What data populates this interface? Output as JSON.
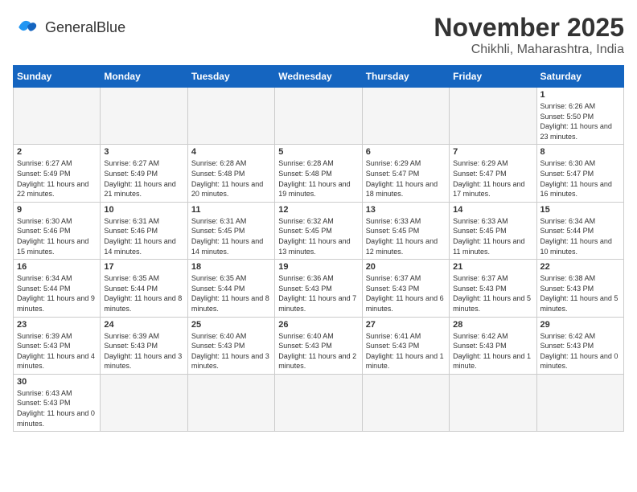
{
  "header": {
    "logo_general": "General",
    "logo_blue": "Blue",
    "month": "November 2025",
    "location": "Chikhli, Maharashtra, India"
  },
  "weekdays": [
    "Sunday",
    "Monday",
    "Tuesday",
    "Wednesday",
    "Thursday",
    "Friday",
    "Saturday"
  ],
  "days": [
    {
      "date": "",
      "sunrise": "",
      "sunset": "",
      "daylight": ""
    },
    {
      "date": "",
      "sunrise": "",
      "sunset": "",
      "daylight": ""
    },
    {
      "date": "",
      "sunrise": "",
      "sunset": "",
      "daylight": ""
    },
    {
      "date": "",
      "sunrise": "",
      "sunset": "",
      "daylight": ""
    },
    {
      "date": "",
      "sunrise": "",
      "sunset": "",
      "daylight": ""
    },
    {
      "date": "",
      "sunrise": "",
      "sunset": "",
      "daylight": ""
    },
    {
      "date": "1",
      "sunrise": "Sunrise: 6:26 AM",
      "sunset": "Sunset: 5:50 PM",
      "daylight": "Daylight: 11 hours and 23 minutes."
    },
    {
      "date": "2",
      "sunrise": "Sunrise: 6:27 AM",
      "sunset": "Sunset: 5:49 PM",
      "daylight": "Daylight: 11 hours and 22 minutes."
    },
    {
      "date": "3",
      "sunrise": "Sunrise: 6:27 AM",
      "sunset": "Sunset: 5:49 PM",
      "daylight": "Daylight: 11 hours and 21 minutes."
    },
    {
      "date": "4",
      "sunrise": "Sunrise: 6:28 AM",
      "sunset": "Sunset: 5:48 PM",
      "daylight": "Daylight: 11 hours and 20 minutes."
    },
    {
      "date": "5",
      "sunrise": "Sunrise: 6:28 AM",
      "sunset": "Sunset: 5:48 PM",
      "daylight": "Daylight: 11 hours and 19 minutes."
    },
    {
      "date": "6",
      "sunrise": "Sunrise: 6:29 AM",
      "sunset": "Sunset: 5:47 PM",
      "daylight": "Daylight: 11 hours and 18 minutes."
    },
    {
      "date": "7",
      "sunrise": "Sunrise: 6:29 AM",
      "sunset": "Sunset: 5:47 PM",
      "daylight": "Daylight: 11 hours and 17 minutes."
    },
    {
      "date": "8",
      "sunrise": "Sunrise: 6:30 AM",
      "sunset": "Sunset: 5:47 PM",
      "daylight": "Daylight: 11 hours and 16 minutes."
    },
    {
      "date": "9",
      "sunrise": "Sunrise: 6:30 AM",
      "sunset": "Sunset: 5:46 PM",
      "daylight": "Daylight: 11 hours and 15 minutes."
    },
    {
      "date": "10",
      "sunrise": "Sunrise: 6:31 AM",
      "sunset": "Sunset: 5:46 PM",
      "daylight": "Daylight: 11 hours and 14 minutes."
    },
    {
      "date": "11",
      "sunrise": "Sunrise: 6:31 AM",
      "sunset": "Sunset: 5:45 PM",
      "daylight": "Daylight: 11 hours and 14 minutes."
    },
    {
      "date": "12",
      "sunrise": "Sunrise: 6:32 AM",
      "sunset": "Sunset: 5:45 PM",
      "daylight": "Daylight: 11 hours and 13 minutes."
    },
    {
      "date": "13",
      "sunrise": "Sunrise: 6:33 AM",
      "sunset": "Sunset: 5:45 PM",
      "daylight": "Daylight: 11 hours and 12 minutes."
    },
    {
      "date": "14",
      "sunrise": "Sunrise: 6:33 AM",
      "sunset": "Sunset: 5:45 PM",
      "daylight": "Daylight: 11 hours and 11 minutes."
    },
    {
      "date": "15",
      "sunrise": "Sunrise: 6:34 AM",
      "sunset": "Sunset: 5:44 PM",
      "daylight": "Daylight: 11 hours and 10 minutes."
    },
    {
      "date": "16",
      "sunrise": "Sunrise: 6:34 AM",
      "sunset": "Sunset: 5:44 PM",
      "daylight": "Daylight: 11 hours and 9 minutes."
    },
    {
      "date": "17",
      "sunrise": "Sunrise: 6:35 AM",
      "sunset": "Sunset: 5:44 PM",
      "daylight": "Daylight: 11 hours and 8 minutes."
    },
    {
      "date": "18",
      "sunrise": "Sunrise: 6:35 AM",
      "sunset": "Sunset: 5:44 PM",
      "daylight": "Daylight: 11 hours and 8 minutes."
    },
    {
      "date": "19",
      "sunrise": "Sunrise: 6:36 AM",
      "sunset": "Sunset: 5:43 PM",
      "daylight": "Daylight: 11 hours and 7 minutes."
    },
    {
      "date": "20",
      "sunrise": "Sunrise: 6:37 AM",
      "sunset": "Sunset: 5:43 PM",
      "daylight": "Daylight: 11 hours and 6 minutes."
    },
    {
      "date": "21",
      "sunrise": "Sunrise: 6:37 AM",
      "sunset": "Sunset: 5:43 PM",
      "daylight": "Daylight: 11 hours and 5 minutes."
    },
    {
      "date": "22",
      "sunrise": "Sunrise: 6:38 AM",
      "sunset": "Sunset: 5:43 PM",
      "daylight": "Daylight: 11 hours and 5 minutes."
    },
    {
      "date": "23",
      "sunrise": "Sunrise: 6:39 AM",
      "sunset": "Sunset: 5:43 PM",
      "daylight": "Daylight: 11 hours and 4 minutes."
    },
    {
      "date": "24",
      "sunrise": "Sunrise: 6:39 AM",
      "sunset": "Sunset: 5:43 PM",
      "daylight": "Daylight: 11 hours and 3 minutes."
    },
    {
      "date": "25",
      "sunrise": "Sunrise: 6:40 AM",
      "sunset": "Sunset: 5:43 PM",
      "daylight": "Daylight: 11 hours and 3 minutes."
    },
    {
      "date": "26",
      "sunrise": "Sunrise: 6:40 AM",
      "sunset": "Sunset: 5:43 PM",
      "daylight": "Daylight: 11 hours and 2 minutes."
    },
    {
      "date": "27",
      "sunrise": "Sunrise: 6:41 AM",
      "sunset": "Sunset: 5:43 PM",
      "daylight": "Daylight: 11 hours and 1 minute."
    },
    {
      "date": "28",
      "sunrise": "Sunrise: 6:42 AM",
      "sunset": "Sunset: 5:43 PM",
      "daylight": "Daylight: 11 hours and 1 minute."
    },
    {
      "date": "29",
      "sunrise": "Sunrise: 6:42 AM",
      "sunset": "Sunset: 5:43 PM",
      "daylight": "Daylight: 11 hours and 0 minutes."
    },
    {
      "date": "30",
      "sunrise": "Sunrise: 6:43 AM",
      "sunset": "Sunset: 5:43 PM",
      "daylight": "Daylight: 11 hours and 0 minutes."
    },
    {
      "date": "",
      "sunrise": "",
      "sunset": "",
      "daylight": ""
    },
    {
      "date": "",
      "sunrise": "",
      "sunset": "",
      "daylight": ""
    },
    {
      "date": "",
      "sunrise": "",
      "sunset": "",
      "daylight": ""
    },
    {
      "date": "",
      "sunrise": "",
      "sunset": "",
      "daylight": ""
    },
    {
      "date": "",
      "sunrise": "",
      "sunset": "",
      "daylight": ""
    },
    {
      "date": "",
      "sunrise": "",
      "sunset": "",
      "daylight": ""
    }
  ]
}
